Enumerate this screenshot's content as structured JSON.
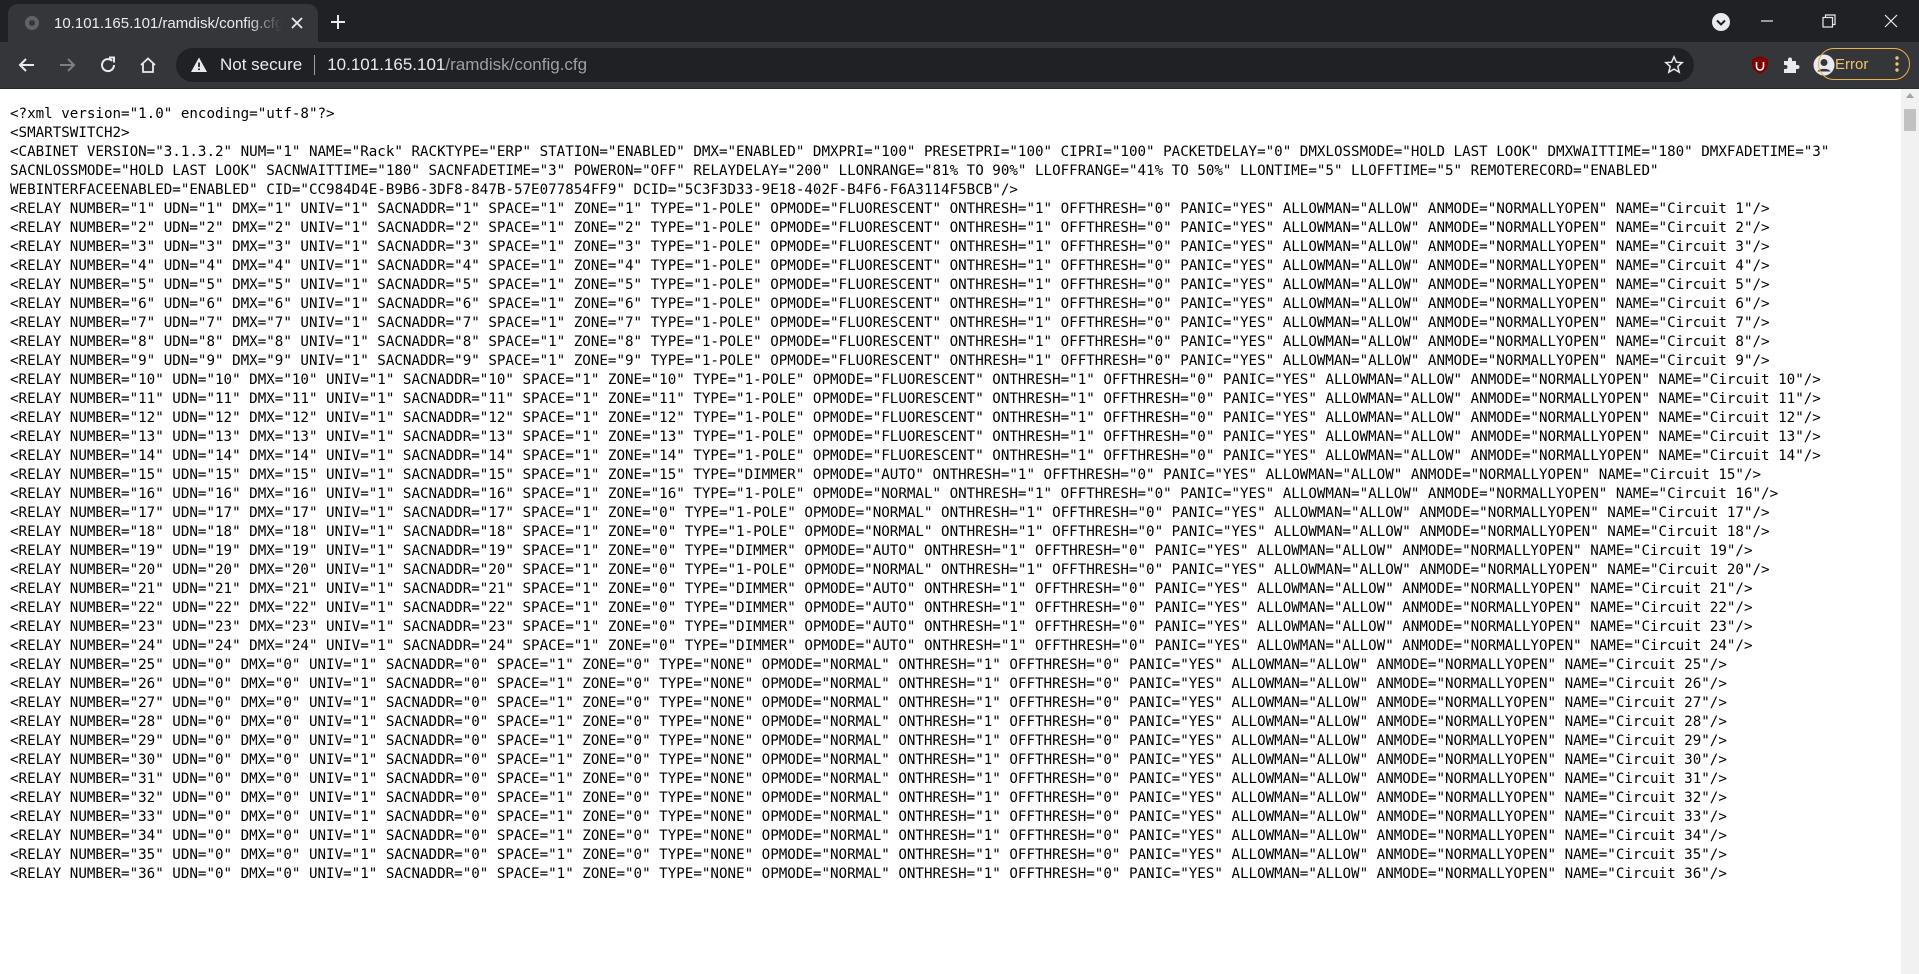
{
  "browser": {
    "tab_title": "10.101.165.101/ramdisk/config.cfg",
    "security_label": "Not secure",
    "url_host": "10.101.165.101",
    "url_path": "/ramdisk/config.cfg",
    "error_label": "Error",
    "colors": {
      "frame": "#202124",
      "toolbar": "#35363a",
      "error_accent": "#e9b24a"
    }
  },
  "document": {
    "lines": [
      "<?xml version=\"1.0\" encoding=\"utf-8\"?>",
      "<SMARTSWITCH2>",
      "<CABINET VERSION=\"3.1.3.2\" NUM=\"1\" NAME=\"Rack\" RACKTYPE=\"ERP\" STATION=\"ENABLED\" DMX=\"ENABLED\" DMXPRI=\"100\" PRESETPRI=\"100\" CIPRI=\"100\" PACKETDELAY=\"0\" DMXLOSSMODE=\"HOLD LAST LOOK\" DMXWAITTIME=\"180\" DMXFADETIME=\"3\" SACNLOSSMODE=\"HOLD LAST LOOK\" SACNWAITTIME=\"180\" SACNFADETIME=\"3\" POWERON=\"OFF\" RELAYDELAY=\"200\" LLONRANGE=\"81% TO 90%\" LLOFFRANGE=\"41% TO 50%\" LLONTIME=\"5\" LLOFFTIME=\"5\" REMOTERECORD=\"ENABLED\" WEBINTERFACEENABLED=\"ENABLED\" CID=\"CC984D4E-B9B6-3DF8-847B-57E077854FF9\" DCID=\"5C3F3D33-9E18-402F-B4F6-F6A3114F5BCB\"/>",
      "<RELAY NUMBER=\"1\" UDN=\"1\" DMX=\"1\" UNIV=\"1\" SACNADDR=\"1\" SPACE=\"1\" ZONE=\"1\" TYPE=\"1-POLE\" OPMODE=\"FLUORESCENT\" ONTHRESH=\"1\" OFFTHRESH=\"0\" PANIC=\"YES\" ALLOWMAN=\"ALLOW\" ANMODE=\"NORMALLYOPEN\" NAME=\"Circuit 1\"/>",
      "<RELAY NUMBER=\"2\" UDN=\"2\" DMX=\"2\" UNIV=\"1\" SACNADDR=\"2\" SPACE=\"1\" ZONE=\"2\" TYPE=\"1-POLE\" OPMODE=\"FLUORESCENT\" ONTHRESH=\"1\" OFFTHRESH=\"0\" PANIC=\"YES\" ALLOWMAN=\"ALLOW\" ANMODE=\"NORMALLYOPEN\" NAME=\"Circuit 2\"/>",
      "<RELAY NUMBER=\"3\" UDN=\"3\" DMX=\"3\" UNIV=\"1\" SACNADDR=\"3\" SPACE=\"1\" ZONE=\"3\" TYPE=\"1-POLE\" OPMODE=\"FLUORESCENT\" ONTHRESH=\"1\" OFFTHRESH=\"0\" PANIC=\"YES\" ALLOWMAN=\"ALLOW\" ANMODE=\"NORMALLYOPEN\" NAME=\"Circuit 3\"/>",
      "<RELAY NUMBER=\"4\" UDN=\"4\" DMX=\"4\" UNIV=\"1\" SACNADDR=\"4\" SPACE=\"1\" ZONE=\"4\" TYPE=\"1-POLE\" OPMODE=\"FLUORESCENT\" ONTHRESH=\"1\" OFFTHRESH=\"0\" PANIC=\"YES\" ALLOWMAN=\"ALLOW\" ANMODE=\"NORMALLYOPEN\" NAME=\"Circuit 4\"/>",
      "<RELAY NUMBER=\"5\" UDN=\"5\" DMX=\"5\" UNIV=\"1\" SACNADDR=\"5\" SPACE=\"1\" ZONE=\"5\" TYPE=\"1-POLE\" OPMODE=\"FLUORESCENT\" ONTHRESH=\"1\" OFFTHRESH=\"0\" PANIC=\"YES\" ALLOWMAN=\"ALLOW\" ANMODE=\"NORMALLYOPEN\" NAME=\"Circuit 5\"/>",
      "<RELAY NUMBER=\"6\" UDN=\"6\" DMX=\"6\" UNIV=\"1\" SACNADDR=\"6\" SPACE=\"1\" ZONE=\"6\" TYPE=\"1-POLE\" OPMODE=\"FLUORESCENT\" ONTHRESH=\"1\" OFFTHRESH=\"0\" PANIC=\"YES\" ALLOWMAN=\"ALLOW\" ANMODE=\"NORMALLYOPEN\" NAME=\"Circuit 6\"/>",
      "<RELAY NUMBER=\"7\" UDN=\"7\" DMX=\"7\" UNIV=\"1\" SACNADDR=\"7\" SPACE=\"1\" ZONE=\"7\" TYPE=\"1-POLE\" OPMODE=\"FLUORESCENT\" ONTHRESH=\"1\" OFFTHRESH=\"0\" PANIC=\"YES\" ALLOWMAN=\"ALLOW\" ANMODE=\"NORMALLYOPEN\" NAME=\"Circuit 7\"/>",
      "<RELAY NUMBER=\"8\" UDN=\"8\" DMX=\"8\" UNIV=\"1\" SACNADDR=\"8\" SPACE=\"1\" ZONE=\"8\" TYPE=\"1-POLE\" OPMODE=\"FLUORESCENT\" ONTHRESH=\"1\" OFFTHRESH=\"0\" PANIC=\"YES\" ALLOWMAN=\"ALLOW\" ANMODE=\"NORMALLYOPEN\" NAME=\"Circuit 8\"/>",
      "<RELAY NUMBER=\"9\" UDN=\"9\" DMX=\"9\" UNIV=\"1\" SACNADDR=\"9\" SPACE=\"1\" ZONE=\"9\" TYPE=\"1-POLE\" OPMODE=\"FLUORESCENT\" ONTHRESH=\"1\" OFFTHRESH=\"0\" PANIC=\"YES\" ALLOWMAN=\"ALLOW\" ANMODE=\"NORMALLYOPEN\" NAME=\"Circuit 9\"/>",
      "<RELAY NUMBER=\"10\" UDN=\"10\" DMX=\"10\" UNIV=\"1\" SACNADDR=\"10\" SPACE=\"1\" ZONE=\"10\" TYPE=\"1-POLE\" OPMODE=\"FLUORESCENT\" ONTHRESH=\"1\" OFFTHRESH=\"0\" PANIC=\"YES\" ALLOWMAN=\"ALLOW\" ANMODE=\"NORMALLYOPEN\" NAME=\"Circuit 10\"/>",
      "<RELAY NUMBER=\"11\" UDN=\"11\" DMX=\"11\" UNIV=\"1\" SACNADDR=\"11\" SPACE=\"1\" ZONE=\"11\" TYPE=\"1-POLE\" OPMODE=\"FLUORESCENT\" ONTHRESH=\"1\" OFFTHRESH=\"0\" PANIC=\"YES\" ALLOWMAN=\"ALLOW\" ANMODE=\"NORMALLYOPEN\" NAME=\"Circuit 11\"/>",
      "<RELAY NUMBER=\"12\" UDN=\"12\" DMX=\"12\" UNIV=\"1\" SACNADDR=\"12\" SPACE=\"1\" ZONE=\"12\" TYPE=\"1-POLE\" OPMODE=\"FLUORESCENT\" ONTHRESH=\"1\" OFFTHRESH=\"0\" PANIC=\"YES\" ALLOWMAN=\"ALLOW\" ANMODE=\"NORMALLYOPEN\" NAME=\"Circuit 12\"/>",
      "<RELAY NUMBER=\"13\" UDN=\"13\" DMX=\"13\" UNIV=\"1\" SACNADDR=\"13\" SPACE=\"1\" ZONE=\"13\" TYPE=\"1-POLE\" OPMODE=\"FLUORESCENT\" ONTHRESH=\"1\" OFFTHRESH=\"0\" PANIC=\"YES\" ALLOWMAN=\"ALLOW\" ANMODE=\"NORMALLYOPEN\" NAME=\"Circuit 13\"/>",
      "<RELAY NUMBER=\"14\" UDN=\"14\" DMX=\"14\" UNIV=\"1\" SACNADDR=\"14\" SPACE=\"1\" ZONE=\"14\" TYPE=\"1-POLE\" OPMODE=\"FLUORESCENT\" ONTHRESH=\"1\" OFFTHRESH=\"0\" PANIC=\"YES\" ALLOWMAN=\"ALLOW\" ANMODE=\"NORMALLYOPEN\" NAME=\"Circuit 14\"/>",
      "<RELAY NUMBER=\"15\" UDN=\"15\" DMX=\"15\" UNIV=\"1\" SACNADDR=\"15\" SPACE=\"1\" ZONE=\"15\" TYPE=\"DIMMER\" OPMODE=\"AUTO\" ONTHRESH=\"1\" OFFTHRESH=\"0\" PANIC=\"YES\" ALLOWMAN=\"ALLOW\" ANMODE=\"NORMALLYOPEN\" NAME=\"Circuit 15\"/>",
      "<RELAY NUMBER=\"16\" UDN=\"16\" DMX=\"16\" UNIV=\"1\" SACNADDR=\"16\" SPACE=\"1\" ZONE=\"16\" TYPE=\"1-POLE\" OPMODE=\"NORMAL\" ONTHRESH=\"1\" OFFTHRESH=\"0\" PANIC=\"YES\" ALLOWMAN=\"ALLOW\" ANMODE=\"NORMALLYOPEN\" NAME=\"Circuit 16\"/>",
      "<RELAY NUMBER=\"17\" UDN=\"17\" DMX=\"17\" UNIV=\"1\" SACNADDR=\"17\" SPACE=\"1\" ZONE=\"0\" TYPE=\"1-POLE\" OPMODE=\"NORMAL\" ONTHRESH=\"1\" OFFTHRESH=\"0\" PANIC=\"YES\" ALLOWMAN=\"ALLOW\" ANMODE=\"NORMALLYOPEN\" NAME=\"Circuit 17\"/>",
      "<RELAY NUMBER=\"18\" UDN=\"18\" DMX=\"18\" UNIV=\"1\" SACNADDR=\"18\" SPACE=\"1\" ZONE=\"0\" TYPE=\"1-POLE\" OPMODE=\"NORMAL\" ONTHRESH=\"1\" OFFTHRESH=\"0\" PANIC=\"YES\" ALLOWMAN=\"ALLOW\" ANMODE=\"NORMALLYOPEN\" NAME=\"Circuit 18\"/>",
      "<RELAY NUMBER=\"19\" UDN=\"19\" DMX=\"19\" UNIV=\"1\" SACNADDR=\"19\" SPACE=\"1\" ZONE=\"0\" TYPE=\"DIMMER\" OPMODE=\"AUTO\" ONTHRESH=\"1\" OFFTHRESH=\"0\" PANIC=\"YES\" ALLOWMAN=\"ALLOW\" ANMODE=\"NORMALLYOPEN\" NAME=\"Circuit 19\"/>",
      "<RELAY NUMBER=\"20\" UDN=\"20\" DMX=\"20\" UNIV=\"1\" SACNADDR=\"20\" SPACE=\"1\" ZONE=\"0\" TYPE=\"1-POLE\" OPMODE=\"NORMAL\" ONTHRESH=\"1\" OFFTHRESH=\"0\" PANIC=\"YES\" ALLOWMAN=\"ALLOW\" ANMODE=\"NORMALLYOPEN\" NAME=\"Circuit 20\"/>",
      "<RELAY NUMBER=\"21\" UDN=\"21\" DMX=\"21\" UNIV=\"1\" SACNADDR=\"21\" SPACE=\"1\" ZONE=\"0\" TYPE=\"DIMMER\" OPMODE=\"AUTO\" ONTHRESH=\"1\" OFFTHRESH=\"0\" PANIC=\"YES\" ALLOWMAN=\"ALLOW\" ANMODE=\"NORMALLYOPEN\" NAME=\"Circuit 21\"/>",
      "<RELAY NUMBER=\"22\" UDN=\"22\" DMX=\"22\" UNIV=\"1\" SACNADDR=\"22\" SPACE=\"1\" ZONE=\"0\" TYPE=\"DIMMER\" OPMODE=\"AUTO\" ONTHRESH=\"1\" OFFTHRESH=\"0\" PANIC=\"YES\" ALLOWMAN=\"ALLOW\" ANMODE=\"NORMALLYOPEN\" NAME=\"Circuit 22\"/>",
      "<RELAY NUMBER=\"23\" UDN=\"23\" DMX=\"23\" UNIV=\"1\" SACNADDR=\"23\" SPACE=\"1\" ZONE=\"0\" TYPE=\"DIMMER\" OPMODE=\"AUTO\" ONTHRESH=\"1\" OFFTHRESH=\"0\" PANIC=\"YES\" ALLOWMAN=\"ALLOW\" ANMODE=\"NORMALLYOPEN\" NAME=\"Circuit 23\"/>",
      "<RELAY NUMBER=\"24\" UDN=\"24\" DMX=\"24\" UNIV=\"1\" SACNADDR=\"24\" SPACE=\"1\" ZONE=\"0\" TYPE=\"DIMMER\" OPMODE=\"AUTO\" ONTHRESH=\"1\" OFFTHRESH=\"0\" PANIC=\"YES\" ALLOWMAN=\"ALLOW\" ANMODE=\"NORMALLYOPEN\" NAME=\"Circuit 24\"/>",
      "<RELAY NUMBER=\"25\" UDN=\"0\" DMX=\"0\" UNIV=\"1\" SACNADDR=\"0\" SPACE=\"1\" ZONE=\"0\" TYPE=\"NONE\" OPMODE=\"NORMAL\" ONTHRESH=\"1\" OFFTHRESH=\"0\" PANIC=\"YES\" ALLOWMAN=\"ALLOW\" ANMODE=\"NORMALLYOPEN\" NAME=\"Circuit 25\"/>",
      "<RELAY NUMBER=\"26\" UDN=\"0\" DMX=\"0\" UNIV=\"1\" SACNADDR=\"0\" SPACE=\"1\" ZONE=\"0\" TYPE=\"NONE\" OPMODE=\"NORMAL\" ONTHRESH=\"1\" OFFTHRESH=\"0\" PANIC=\"YES\" ALLOWMAN=\"ALLOW\" ANMODE=\"NORMALLYOPEN\" NAME=\"Circuit 26\"/>",
      "<RELAY NUMBER=\"27\" UDN=\"0\" DMX=\"0\" UNIV=\"1\" SACNADDR=\"0\" SPACE=\"1\" ZONE=\"0\" TYPE=\"NONE\" OPMODE=\"NORMAL\" ONTHRESH=\"1\" OFFTHRESH=\"0\" PANIC=\"YES\" ALLOWMAN=\"ALLOW\" ANMODE=\"NORMALLYOPEN\" NAME=\"Circuit 27\"/>",
      "<RELAY NUMBER=\"28\" UDN=\"0\" DMX=\"0\" UNIV=\"1\" SACNADDR=\"0\" SPACE=\"1\" ZONE=\"0\" TYPE=\"NONE\" OPMODE=\"NORMAL\" ONTHRESH=\"1\" OFFTHRESH=\"0\" PANIC=\"YES\" ALLOWMAN=\"ALLOW\" ANMODE=\"NORMALLYOPEN\" NAME=\"Circuit 28\"/>",
      "<RELAY NUMBER=\"29\" UDN=\"0\" DMX=\"0\" UNIV=\"1\" SACNADDR=\"0\" SPACE=\"1\" ZONE=\"0\" TYPE=\"NONE\" OPMODE=\"NORMAL\" ONTHRESH=\"1\" OFFTHRESH=\"0\" PANIC=\"YES\" ALLOWMAN=\"ALLOW\" ANMODE=\"NORMALLYOPEN\" NAME=\"Circuit 29\"/>",
      "<RELAY NUMBER=\"30\" UDN=\"0\" DMX=\"0\" UNIV=\"1\" SACNADDR=\"0\" SPACE=\"1\" ZONE=\"0\" TYPE=\"NONE\" OPMODE=\"NORMAL\" ONTHRESH=\"1\" OFFTHRESH=\"0\" PANIC=\"YES\" ALLOWMAN=\"ALLOW\" ANMODE=\"NORMALLYOPEN\" NAME=\"Circuit 30\"/>",
      "<RELAY NUMBER=\"31\" UDN=\"0\" DMX=\"0\" UNIV=\"1\" SACNADDR=\"0\" SPACE=\"1\" ZONE=\"0\" TYPE=\"NONE\" OPMODE=\"NORMAL\" ONTHRESH=\"1\" OFFTHRESH=\"0\" PANIC=\"YES\" ALLOWMAN=\"ALLOW\" ANMODE=\"NORMALLYOPEN\" NAME=\"Circuit 31\"/>",
      "<RELAY NUMBER=\"32\" UDN=\"0\" DMX=\"0\" UNIV=\"1\" SACNADDR=\"0\" SPACE=\"1\" ZONE=\"0\" TYPE=\"NONE\" OPMODE=\"NORMAL\" ONTHRESH=\"1\" OFFTHRESH=\"0\" PANIC=\"YES\" ALLOWMAN=\"ALLOW\" ANMODE=\"NORMALLYOPEN\" NAME=\"Circuit 32\"/>",
      "<RELAY NUMBER=\"33\" UDN=\"0\" DMX=\"0\" UNIV=\"1\" SACNADDR=\"0\" SPACE=\"1\" ZONE=\"0\" TYPE=\"NONE\" OPMODE=\"NORMAL\" ONTHRESH=\"1\" OFFTHRESH=\"0\" PANIC=\"YES\" ALLOWMAN=\"ALLOW\" ANMODE=\"NORMALLYOPEN\" NAME=\"Circuit 33\"/>",
      "<RELAY NUMBER=\"34\" UDN=\"0\" DMX=\"0\" UNIV=\"1\" SACNADDR=\"0\" SPACE=\"1\" ZONE=\"0\" TYPE=\"NONE\" OPMODE=\"NORMAL\" ONTHRESH=\"1\" OFFTHRESH=\"0\" PANIC=\"YES\" ALLOWMAN=\"ALLOW\" ANMODE=\"NORMALLYOPEN\" NAME=\"Circuit 34\"/>",
      "<RELAY NUMBER=\"35\" UDN=\"0\" DMX=\"0\" UNIV=\"1\" SACNADDR=\"0\" SPACE=\"1\" ZONE=\"0\" TYPE=\"NONE\" OPMODE=\"NORMAL\" ONTHRESH=\"1\" OFFTHRESH=\"0\" PANIC=\"YES\" ALLOWMAN=\"ALLOW\" ANMODE=\"NORMALLYOPEN\" NAME=\"Circuit 35\"/>",
      "<RELAY NUMBER=\"36\" UDN=\"0\" DMX=\"0\" UNIV=\"1\" SACNADDR=\"0\" SPACE=\"1\" ZONE=\"0\" TYPE=\"NONE\" OPMODE=\"NORMAL\" ONTHRESH=\"1\" OFFTHRESH=\"0\" PANIC=\"YES\" ALLOWMAN=\"ALLOW\" ANMODE=\"NORMALLYOPEN\" NAME=\"Circuit 36\"/>"
    ]
  }
}
